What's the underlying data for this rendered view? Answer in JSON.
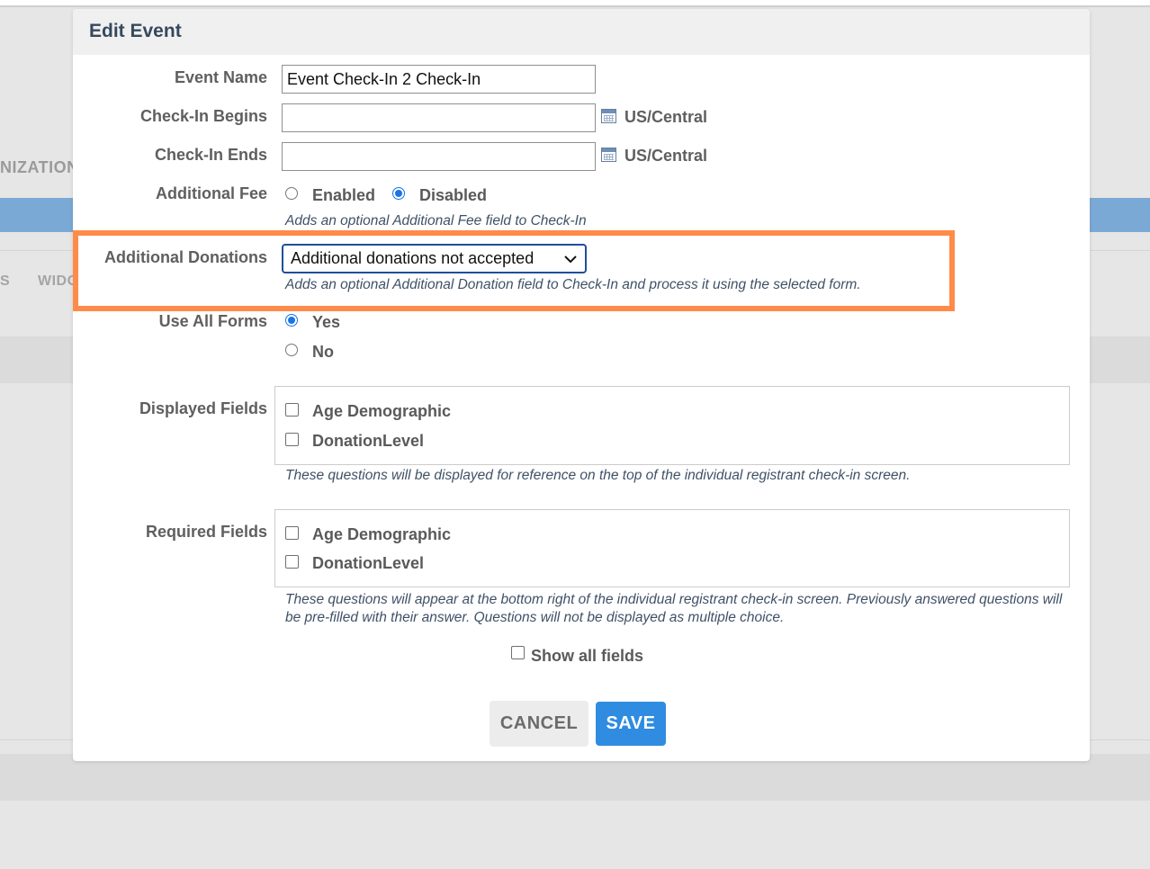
{
  "background": {
    "org_fragment": "NIZATION",
    "nav_fragment_s": "S",
    "nav_fragment_widg": "WIDG"
  },
  "modal": {
    "title": "Edit Event",
    "event_name": {
      "label": "Event Name",
      "value": "Event Check-In 2 Check-In"
    },
    "checkin_begins": {
      "label": "Check-In Begins",
      "value": "",
      "timezone": "US/Central",
      "icon": "calendar-icon"
    },
    "checkin_ends": {
      "label": "Check-In Ends",
      "value": "",
      "timezone": "US/Central",
      "icon": "calendar-icon"
    },
    "additional_fee": {
      "label": "Additional Fee",
      "options": [
        "Enabled",
        "Disabled"
      ],
      "selected": "Disabled",
      "help": "Adds an optional Additional Fee field to Check-In"
    },
    "additional_donations": {
      "label": "Additional Donations",
      "selected": "Additional donations not accepted",
      "help": "Adds an optional Additional Donation field to Check-In and process it using the selected form.",
      "highlight_color": "#ff8b4a"
    },
    "use_all_forms": {
      "label": "Use All Forms",
      "options": [
        "Yes",
        "No"
      ],
      "selected": "Yes"
    },
    "displayed_fields": {
      "label": "Displayed Fields",
      "items": [
        "Age Demographic",
        "DonationLevel"
      ],
      "help": "These questions will be displayed for reference on the top of the individual registrant check-in screen."
    },
    "required_fields": {
      "label": "Required Fields",
      "items": [
        "Age Demographic",
        "DonationLevel"
      ],
      "help": "These questions will appear at the bottom right of the individual registrant check-in screen. Previously answered questions will be pre-filled with their answer. Questions will not be displayed as multiple choice."
    },
    "show_all_fields": {
      "label": "Show all fields",
      "checked": false
    },
    "buttons": {
      "cancel": "CANCEL",
      "save": "SAVE"
    }
  },
  "colors": {
    "accent": "#2f8ce0",
    "title": "#35495e",
    "highlight": "#ff8b4a",
    "background_bar": "#7ba9d6"
  }
}
